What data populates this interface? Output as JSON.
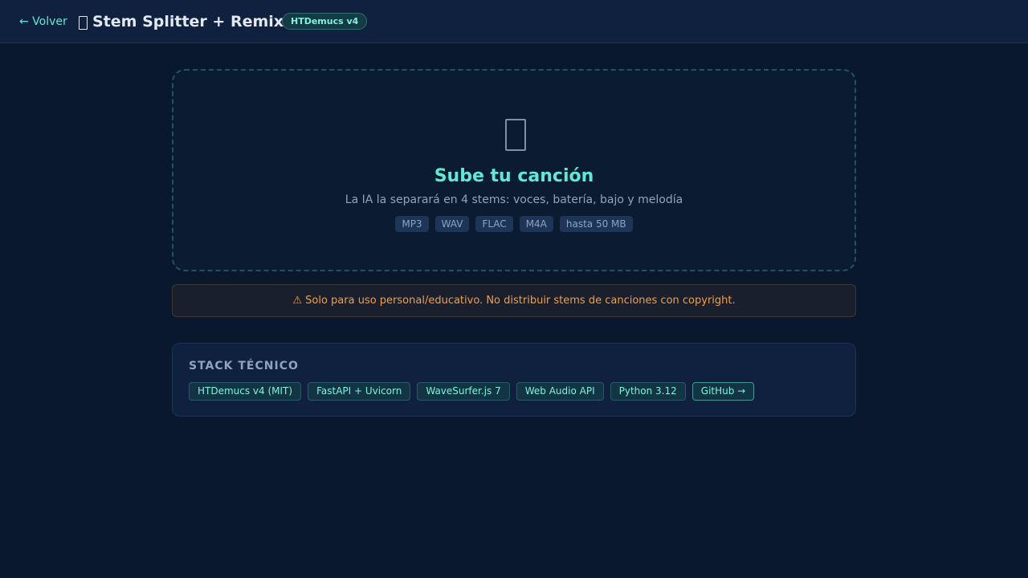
{
  "header": {
    "back_label": "← Volver",
    "title": "Stem Splitter + Remix",
    "title_icon": "file-icon",
    "badge": "HTDemucs v4"
  },
  "upload": {
    "icon": "file-icon",
    "title": "Sube tu canción",
    "subtitle": "La IA la separará en 4 stems: voces, batería, bajo y melodía",
    "formats": [
      "MP3",
      "WAV",
      "FLAC",
      "M4A",
      "hasta 50 MB"
    ]
  },
  "warning": {
    "text": "⚠ Solo para uso personal/educativo. No distribuir stems de canciones con copyright."
  },
  "stack": {
    "heading": "STACK TÉCNICO",
    "items": [
      "HTDemucs v4 (MIT)",
      "FastAPI + Uvicorn",
      "WaveSurfer.js 7",
      "Web Audio API",
      "Python 3.12"
    ],
    "github_label": "GitHub →"
  },
  "colors": {
    "accent": "#5eead4",
    "background": "#0a182e",
    "warning": "#f59e3b"
  }
}
